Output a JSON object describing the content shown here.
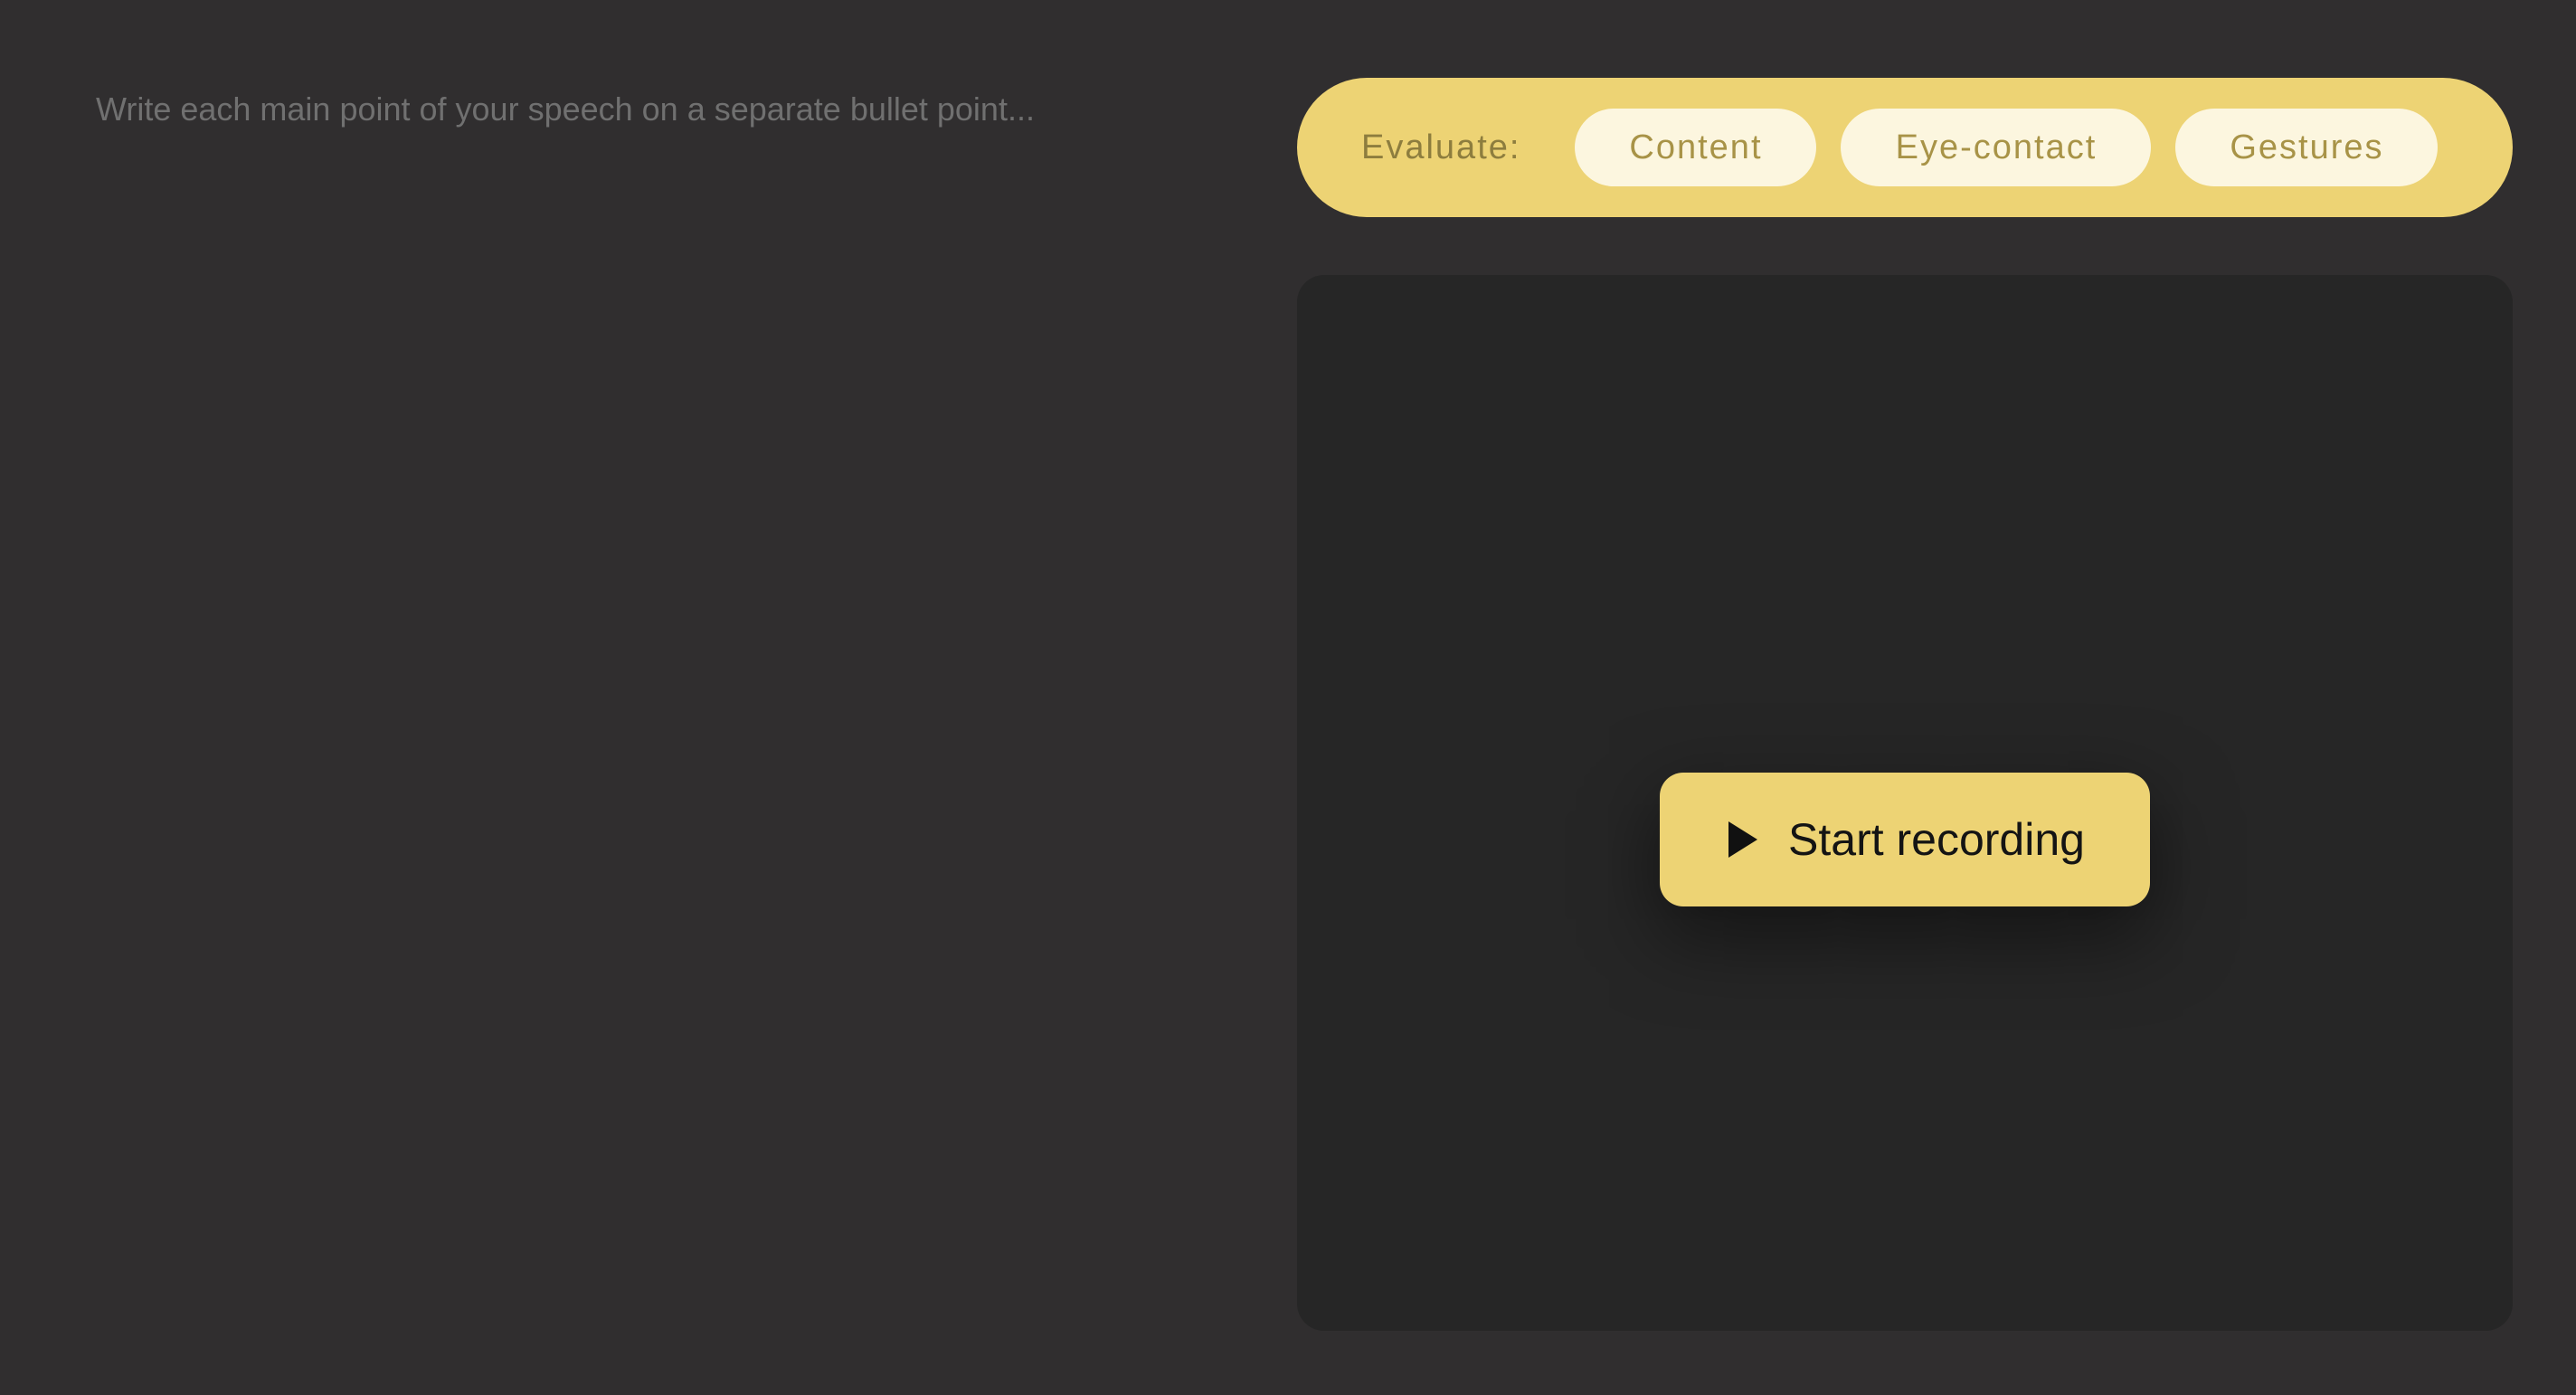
{
  "notes": {
    "placeholder": "Write each main point of your speech on a separate bullet point...",
    "value": ""
  },
  "evaluate": {
    "label": "Evaluate:",
    "options": [
      {
        "label": "Content"
      },
      {
        "label": "Eye-contact"
      },
      {
        "label": "Gestures"
      }
    ]
  },
  "recorder": {
    "start_label": "Start recording",
    "start_icon": "play-icon"
  },
  "colors": {
    "background": "#302e2f",
    "panel": "#262626",
    "accent": "#edd374",
    "chip": "#fcf6df"
  }
}
